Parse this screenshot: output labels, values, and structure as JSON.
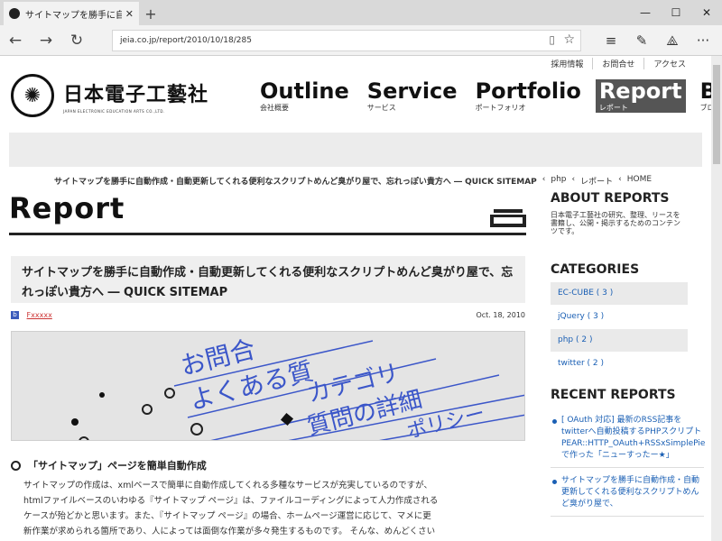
{
  "browser": {
    "tab_title": "サイトマップを勝手に自動作",
    "url": "jeia.co.jp/report/2010/10/18/285"
  },
  "site": {
    "top_links": [
      "採用情報",
      "お問合せ",
      "アクセス"
    ],
    "logo_jp": "日本電子工藝社",
    "logo_en": "JAPAN ELECTRONIC EDUCATION ARTS CO.,LTD.",
    "menu": [
      {
        "en": "Outline",
        "ja": "会社概要"
      },
      {
        "en": "Service",
        "ja": "サービス"
      },
      {
        "en": "Portfolio",
        "ja": "ポートフォリオ"
      },
      {
        "en": "Report",
        "ja": "レポート"
      },
      {
        "en": "Blog",
        "ja": "ブログ"
      }
    ],
    "breadcrumb": [
      "サイトマップを勝手に自動作成・自動更新してくれる便利なスクリプトめんど臭がり屋で、忘れっぽい貴方へ ― QUICK SITEMAP",
      "php",
      "レポート",
      "HOME"
    ]
  },
  "main": {
    "page_title": "Report",
    "post_title": "サイトマップを勝手に自動作成・自動更新してくれる便利なスクリプトめんど臭がり屋で、忘れっぽい貴方へ ― QUICK SITEMAP",
    "author_tag": "Fxxxxx",
    "date": "Oct. 18, 2010",
    "hero_words": [
      "お問合",
      "よくある質",
      "カテゴリ",
      "質問の詳細",
      "ポリシー"
    ],
    "section_heading": "「サイトマップ」ページを簡単自動作成",
    "body_lines": [
      "サイトマップの作成は、xmlベースで簡単に自動作成してくれる多種なサービスが充実しているのですが、",
      "htmlファイルベースのいわゆる『サイトマップ ページ』は、ファイルコーディングによって人力作成される",
      "ケースが殆どかと思います。また、『サイトマップ ページ』の場合、ホームページ運営に応じて、マメに更",
      "新作業が求められる箇所であり、人によっては面倒な作業が多々発生するものです。 そんな、めんどくさい"
    ]
  },
  "sidebar": {
    "about_heading": "ABOUT REPORTS",
    "about_text": "日本電子工藝社の研究、整理、リースを書籍し、公開・掲示するためのコンテンツです。",
    "categories_heading": "CATEGORIES",
    "categories": [
      "EC-CUBE ( 3 )",
      "jQuery ( 3 )",
      "php ( 2 )",
      "twitter ( 2 )"
    ],
    "recent_heading": "RECENT REPORTS",
    "recent": [
      "[ OAuth 対応] 最新のRSS記事をtwitterへ自動投稿するPHPスクリプト PEAR::HTTP_OAuth+RSSxSimplePieで作った「ニューすったー★」",
      "サイトマップを勝手に自動作成・自動更新してくれる便利なスクリプトめんど臭がり屋で、"
    ]
  }
}
